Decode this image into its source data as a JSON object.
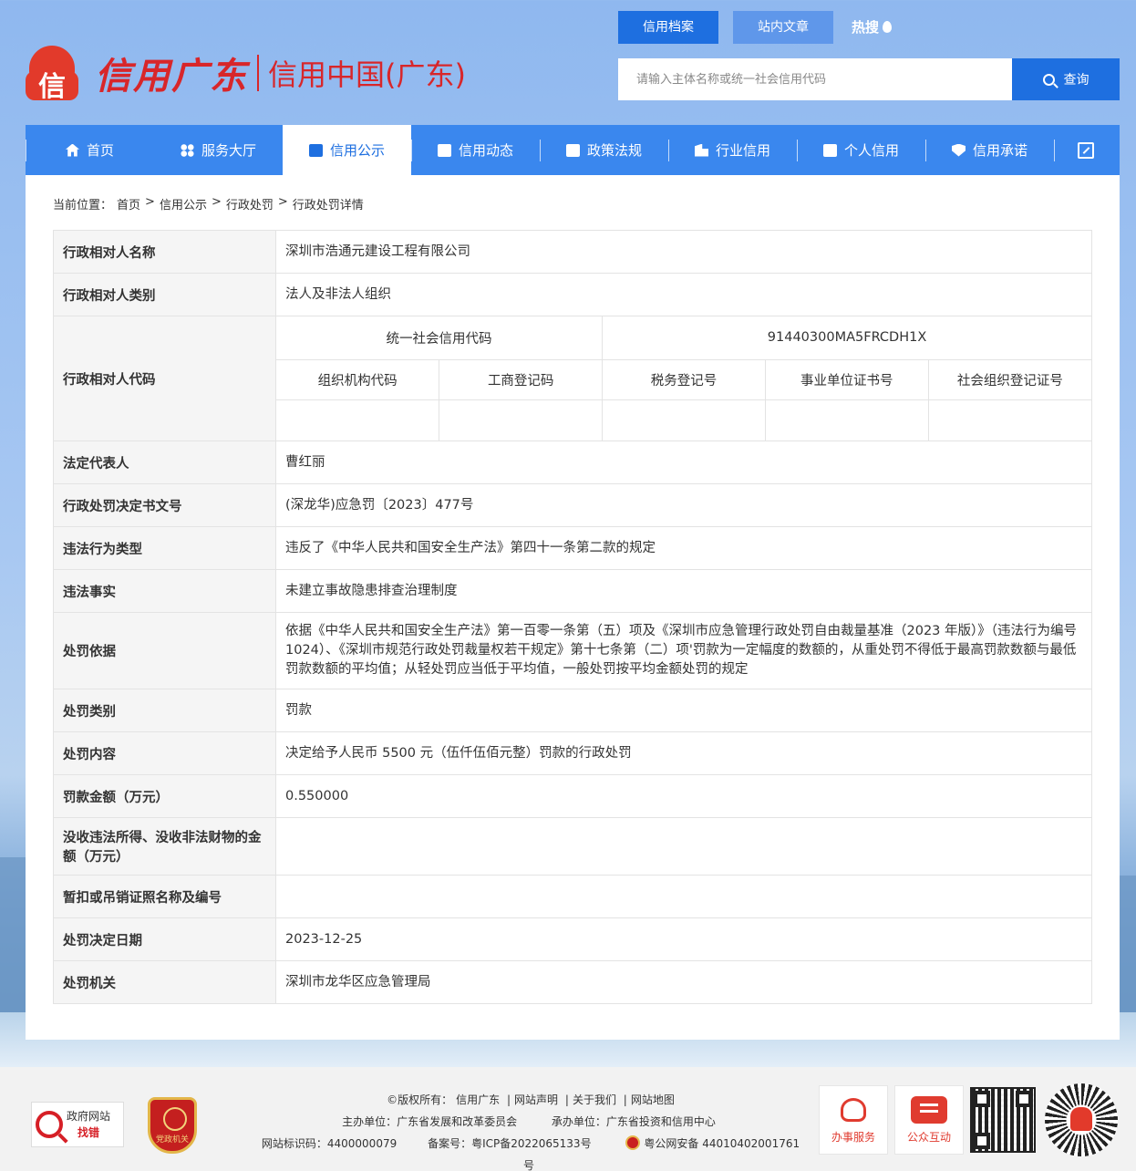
{
  "header": {
    "logo_glyph": "信",
    "logo_cn": "信用广东",
    "logo_sub": "信用中国(广东)",
    "top_tabs": [
      "信用档案",
      "站内文章",
      "热搜"
    ],
    "search_placeholder": "请输入主体名称或统一社会信用代码",
    "search_btn": "查询"
  },
  "nav": {
    "items": [
      "首页",
      "服务大厅",
      "信用公示",
      "信用动态",
      "政策法规",
      "行业信用",
      "个人信用",
      "信用承诺"
    ],
    "active_index": 2
  },
  "breadcrumb": {
    "prefix": "当前位置：",
    "items": [
      "首页",
      "信用公示",
      "行政处罚",
      "行政处罚详情"
    ],
    "sep": ">"
  },
  "detail": {
    "name_label": "行政相对人名称",
    "name": "深圳市浩通元建设工程有限公司",
    "category_label": "行政相对人类别",
    "category": "法人及非法人组织",
    "code_label": "行政相对人代码",
    "uscc_label": "统一社会信用代码",
    "uscc": "91440300MA5FRCDH1X",
    "sub_codes": [
      "组织机构代码",
      "工商登记码",
      "税务登记号",
      "事业单位证书号",
      "社会组织登记证号"
    ],
    "legal_rep_label": "法定代表人",
    "legal_rep": "曹红丽",
    "doc_no_label": "行政处罚决定书文号",
    "doc_no": "(深龙华)应急罚〔2023〕477号",
    "violation_type_label": "违法行为类型",
    "violation_type": "违反了《中华人民共和国安全生产法》第四十一条第二款的规定",
    "facts_label": "违法事实",
    "facts": "未建立事故隐患排查治理制度",
    "basis_label": "处罚依据",
    "basis": "依据《中华人民共和国安全生产法》第一百零一条第（五）项及《深圳市应急管理行政处罚自由裁量基准（2023 年版）》（违法行为编号 1024）、《深圳市规范行政处罚裁量权若干规定》第十七条第（二）项'罚款为一定幅度的数额的，从重处罚不得低于最高罚款数额与最低罚款数额的平均值；从轻处罚应当低于平均值，一般处罚按平均金额处罚的规定",
    "penalty_type_label": "处罚类别",
    "penalty_type": "罚款",
    "content_label": "处罚内容",
    "content": "决定给予人民币 5500 元（伍仟伍佰元整）罚款的行政处罚",
    "amount_label": "罚款金额（万元）",
    "amount": "0.550000",
    "confiscation_label": "没收违法所得、没收非法财物的金额（万元）",
    "confiscation": "",
    "license_label": "暂扣或吊销证照名称及编号",
    "license": "",
    "date_label": "处罚决定日期",
    "date": "2023-12-25",
    "authority_label": "处罚机关",
    "authority": "深圳市龙华区应急管理局"
  },
  "footer": {
    "gov_site_line1": "政府网站",
    "gov_site_line2": "找错",
    "party_label": "党政机关",
    "copyright_prefix": "©版权所有：",
    "copyright_owner": "信用广东",
    "links": [
      "网站声明",
      "关于我们",
      "网站地图"
    ],
    "sponsor": "主办单位：广东省发展和改革委员会",
    "organizer": "承办单位：广东省投资和信用中心",
    "site_id": "网站标识码：4400000079",
    "icp": "备案号：粤ICP备2022065133号",
    "police": "粤公网安备 44010402001761号",
    "btn_service": "办事服务",
    "btn_interact": "公众互动"
  },
  "colors": {
    "nav_bg": "#3a87ee",
    "accent": "#1e6fe0",
    "brand_red": "#d8262a"
  }
}
